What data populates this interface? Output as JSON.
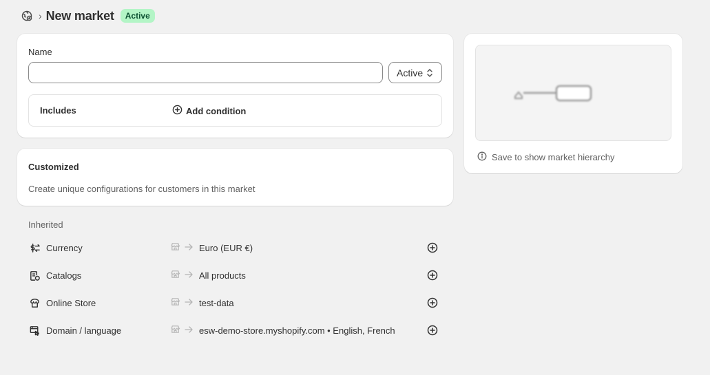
{
  "header": {
    "title": "New market",
    "status_badge": "Active",
    "breadcrumb_icon": "globe-icon"
  },
  "name_card": {
    "name_label": "Name",
    "name_value": "",
    "name_placeholder": "",
    "status_value": "Active",
    "includes_label": "Includes",
    "add_condition_label": "Add condition"
  },
  "customized_card": {
    "title": "Customized",
    "description": "Create unique configurations for customers in this market"
  },
  "inherited": {
    "label": "Inherited",
    "rows": [
      {
        "icon": "currency-icon",
        "label": "Currency",
        "value": "Euro (EUR €)"
      },
      {
        "icon": "catalog-icon",
        "label": "Catalogs",
        "value": "All products"
      },
      {
        "icon": "online-store-icon",
        "label": "Online Store",
        "value": "test-data"
      },
      {
        "icon": "domain-icon",
        "label": "Domain / language",
        "value": "esw-demo-store.myshopify.com • English, French"
      }
    ]
  },
  "hierarchy_card": {
    "note": "Save to show market hierarchy"
  },
  "colors": {
    "page_bg": "#f1f1f1",
    "card_bg": "#ffffff",
    "badge_bg": "#b3f5c6",
    "badge_text": "#0c5132",
    "text_primary": "#303030",
    "text_secondary": "#616161"
  }
}
